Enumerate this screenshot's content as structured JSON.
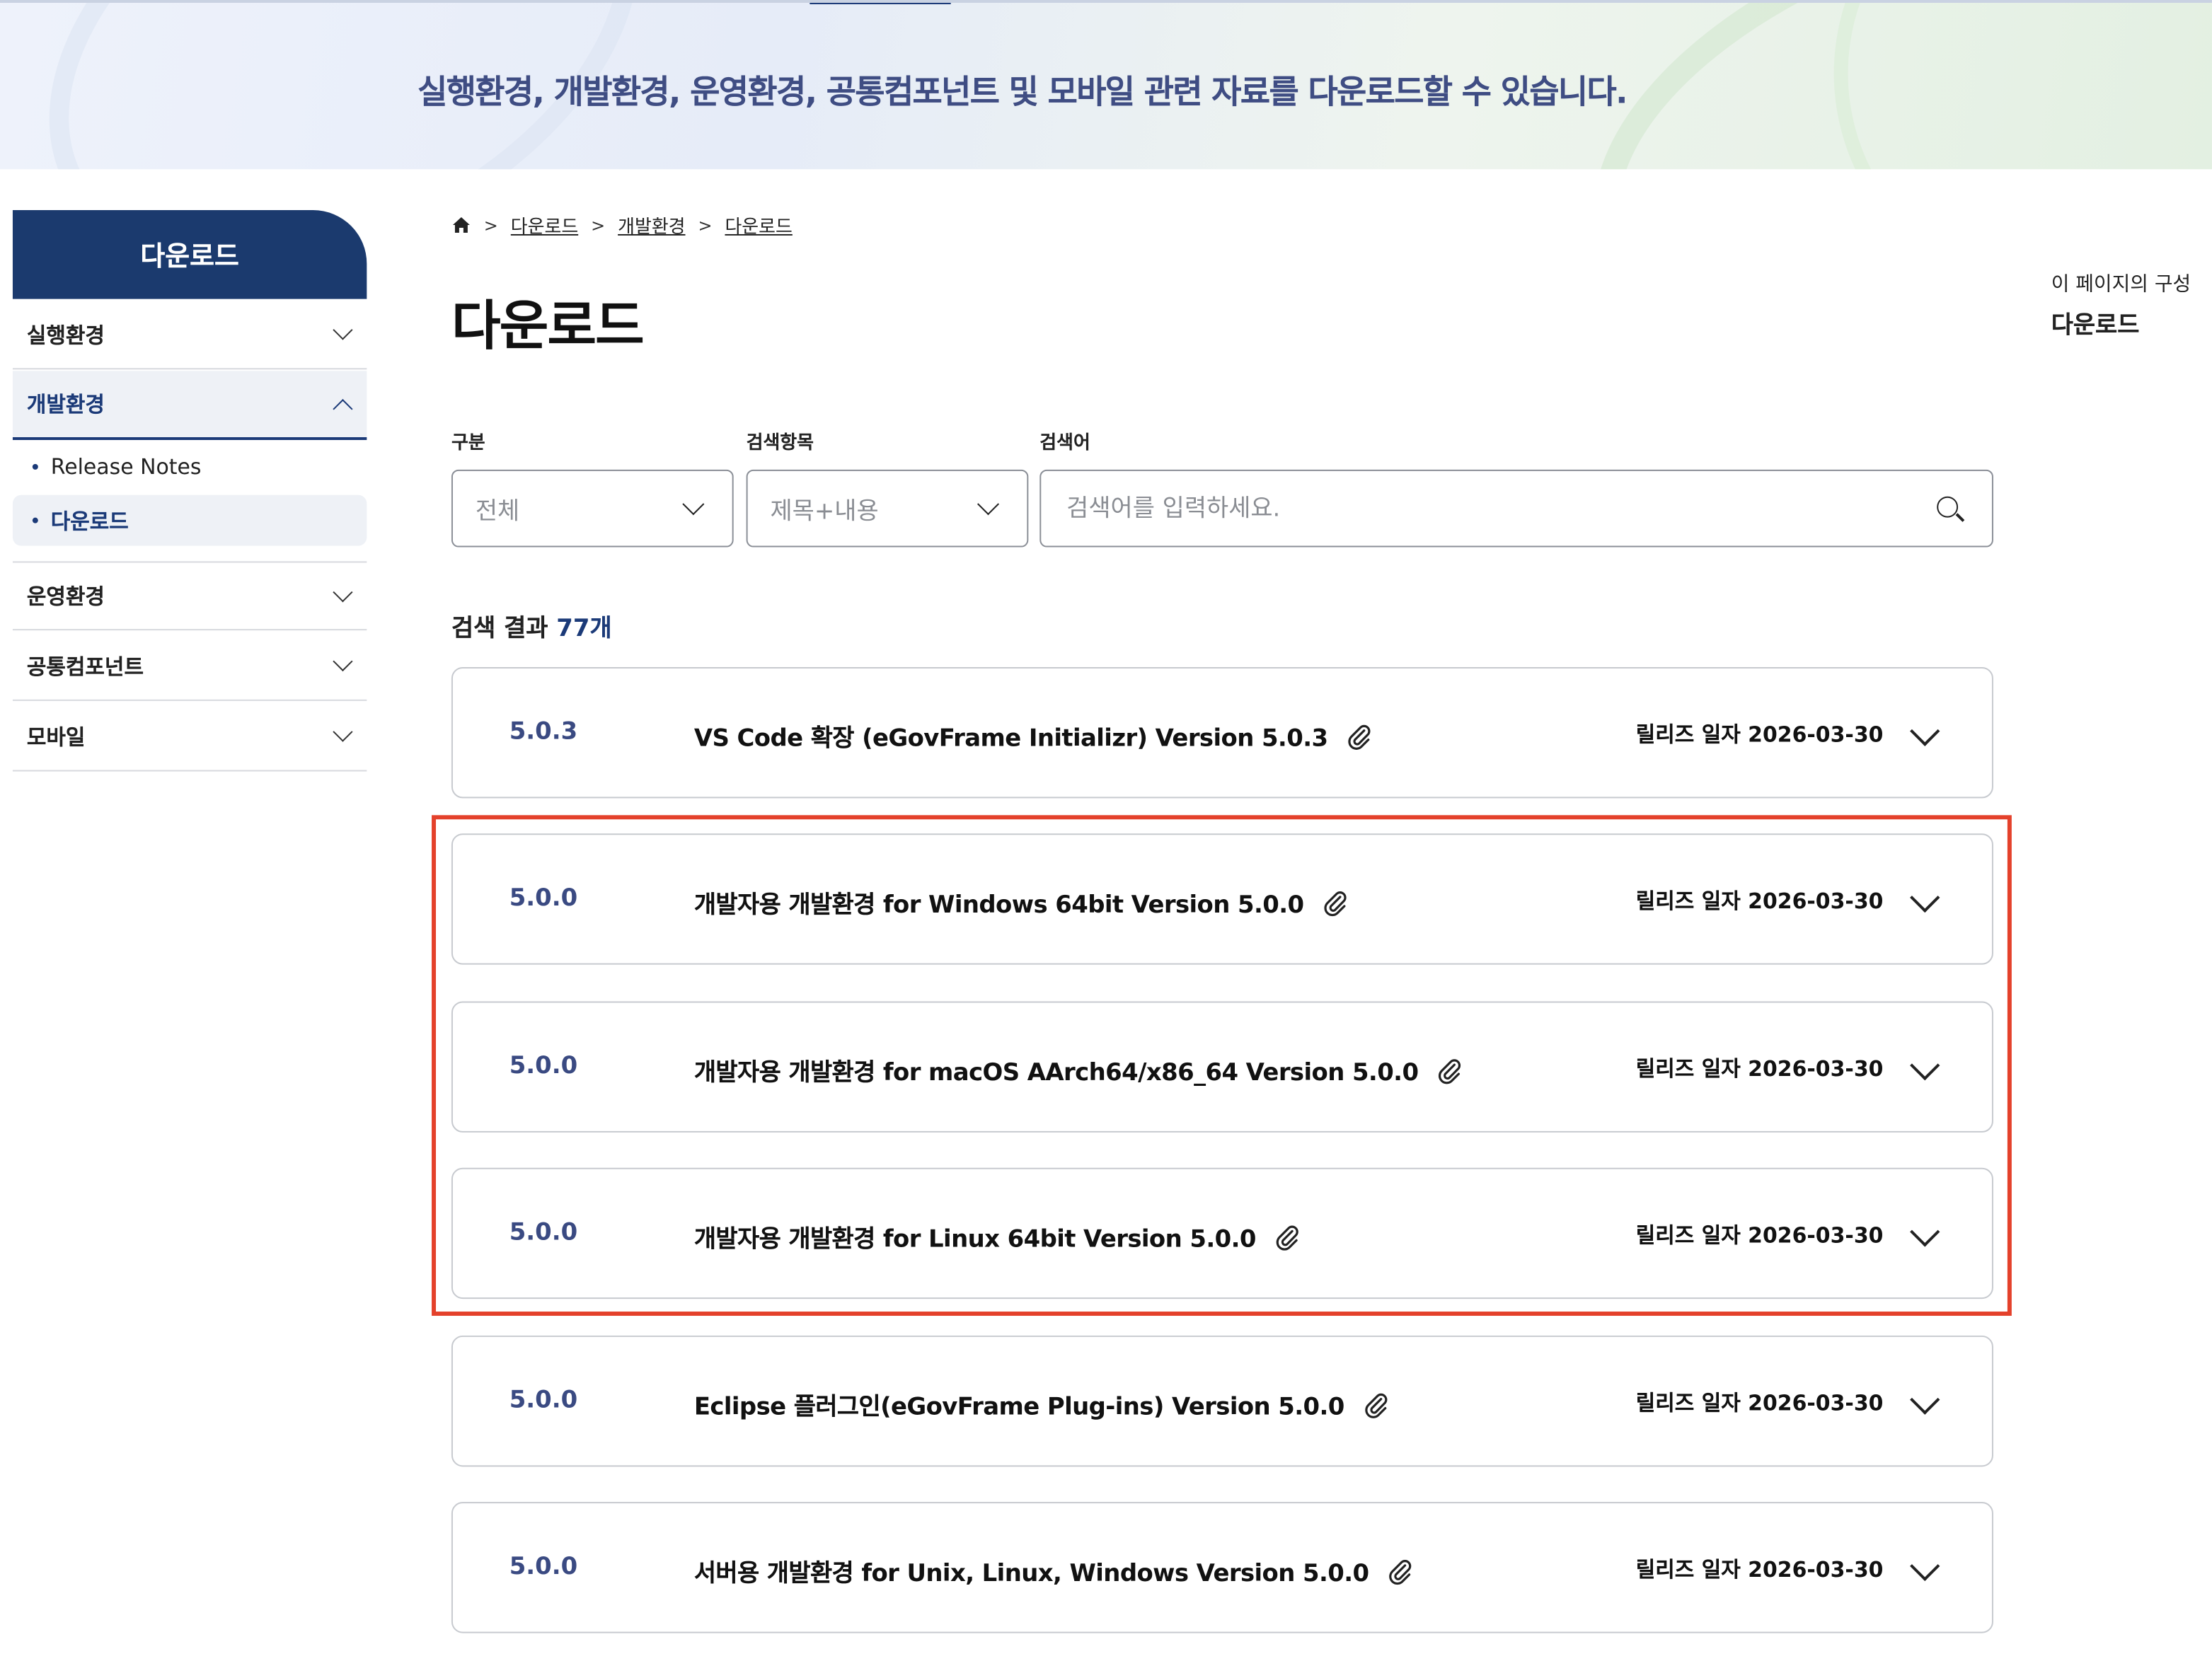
{
  "banner": {
    "text": "실행환경, 개발환경, 운영환경, 공통컴포넌트 및 모바일 관련 자료를 다운로드할 수 있습니다."
  },
  "sidebar": {
    "title": "다운로드",
    "items": [
      {
        "label": "실행환경"
      },
      {
        "label": "개발환경"
      },
      {
        "label": "운영환경"
      },
      {
        "label": "공통컴포넌트"
      },
      {
        "label": "모바일"
      }
    ],
    "subitems": [
      {
        "label": "Release Notes"
      },
      {
        "label": "다운로드"
      }
    ]
  },
  "breadcrumb": {
    "items": [
      "다운로드",
      "개발환경",
      "다운로드"
    ]
  },
  "page_title": "다운로드",
  "toc": {
    "caption": "이 페이지의 구성",
    "item": "다운로드"
  },
  "filters": {
    "category_label": "구분",
    "category_value": "전체",
    "field_label": "검색항목",
    "field_value": "제목+내용",
    "keyword_label": "검색어",
    "keyword_placeholder": "검색어를 입력하세요."
  },
  "results": {
    "prefix": "검색 결과 ",
    "count": "77개"
  },
  "rows": [
    {
      "version": "5.0.3",
      "title": "VS Code 확장 (eGovFrame Initializr) Version 5.0.3",
      "date": "릴리즈 일자 2026-03-30"
    },
    {
      "version": "5.0.0",
      "title": "개발자용 개발환경 for Windows 64bit Version 5.0.0",
      "date": "릴리즈 일자 2026-03-30"
    },
    {
      "version": "5.0.0",
      "title": "개발자용 개발환경 for macOS AArch64/x86_64 Version 5.0.0",
      "date": "릴리즈 일자 2026-03-30"
    },
    {
      "version": "5.0.0",
      "title": "개발자용 개발환경 for Linux 64bit Version 5.0.0",
      "date": "릴리즈 일자 2026-03-30"
    },
    {
      "version": "5.0.0",
      "title": "Eclipse 플러그인(eGovFrame Plug-ins) Version 5.0.0",
      "date": "릴리즈 일자 2026-03-30"
    },
    {
      "version": "5.0.0",
      "title": "서버용 개발환경 for Unix, Linux, Windows Version 5.0.0",
      "date": "릴리즈 일자 2026-03-30"
    }
  ],
  "colors": {
    "brand": "#1b3a6e",
    "highlight": "#e4412b",
    "version_text": "#3a4a82"
  }
}
